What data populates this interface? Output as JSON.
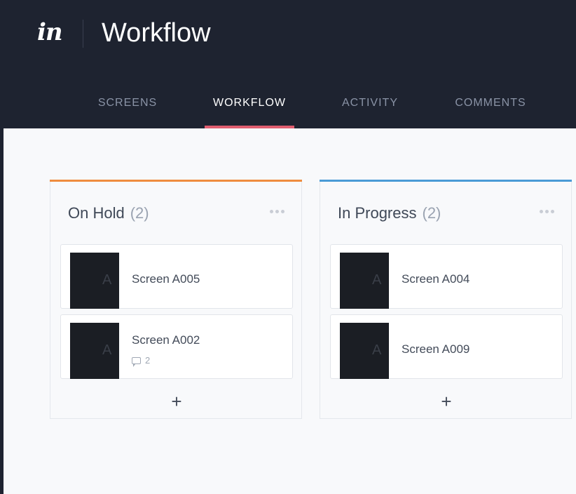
{
  "header": {
    "logo_text": "in",
    "title": "Workflow"
  },
  "tabs": [
    {
      "label": "SCREENS"
    },
    {
      "label": "WORKFLOW",
      "active": true
    },
    {
      "label": "ACTIVITY"
    },
    {
      "label": "COMMENTS"
    }
  ],
  "columns": [
    {
      "title": "On Hold",
      "count": "(2)",
      "accent": "#ef8c3f",
      "cards": [
        {
          "title": "Screen A005",
          "thumb_text": "A"
        },
        {
          "title": "Screen A002",
          "thumb_text": "A",
          "comments": "2"
        }
      ],
      "add_label": "+"
    },
    {
      "title": "In Progress",
      "count": "(2)",
      "accent": "#4a9bd6",
      "cards": [
        {
          "title": "Screen A004",
          "thumb_text": "A"
        },
        {
          "title": "Screen A009",
          "thumb_text": "A"
        }
      ],
      "add_label": "+"
    }
  ],
  "colors": {
    "header_bg": "#1e2330",
    "active_tab_underline": "#e05d6f",
    "content_bg": "#f8f9fb"
  }
}
